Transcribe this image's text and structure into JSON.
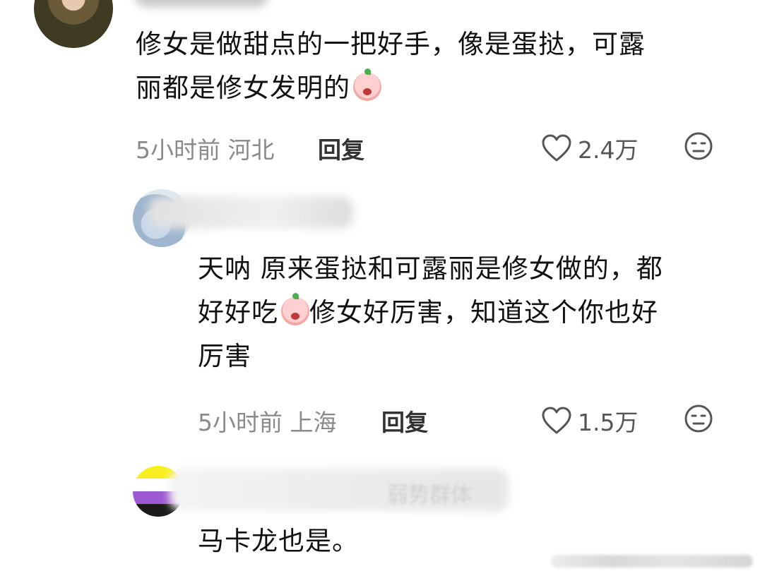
{
  "comments": [
    {
      "text_line1": "修女是做甜点的一把好手，像是蛋挞，可露",
      "text_line2": "丽都是修女发明的",
      "time": "5小时前",
      "location": "河北",
      "reply_label": "回复",
      "likes": "2.4万"
    },
    {
      "text_line1": "天呐 原来蛋挞和可露丽是修女做的，都",
      "text_line2_a": "好好吃",
      "text_line2_b": "修女好厉害，知道这个你也好",
      "text_line3": "厉害",
      "time": "5小时前",
      "location": "上海",
      "reply_label": "回复",
      "likes": "1.5万"
    },
    {
      "username_tail": "弱势群体",
      "text_line1": "马卡龙也是。"
    }
  ],
  "icons": {
    "like": "heart-outline-icon",
    "dislike": "neutral-face-icon",
    "emoji": "peach-emoji-icon"
  },
  "colors": {
    "text": "#111111",
    "meta": "#8a8a8a",
    "icon": "#555555"
  }
}
